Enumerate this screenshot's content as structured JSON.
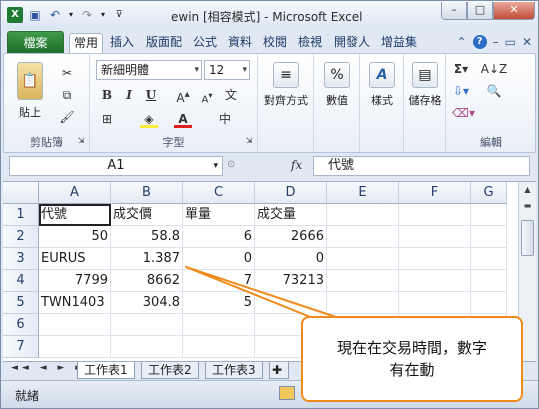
{
  "window": {
    "title": "ewin  [相容模式] - Microsoft Excel"
  },
  "titlebar": {
    "minimize": "–",
    "maximize": "□",
    "close": "✕"
  },
  "ribbon_tabs": {
    "file": "檔案",
    "tabs": [
      "常用",
      "插入",
      "版面配",
      "公式",
      "資料",
      "校閱",
      "檢視",
      "開發人",
      "增益集"
    ]
  },
  "ribbon": {
    "clipboard": {
      "label": "剪貼簿",
      "paste": "貼上"
    },
    "font": {
      "label": "字型",
      "name": "新細明體",
      "size": "12",
      "bold": "B",
      "italic": "I",
      "underline": "U"
    },
    "alignment": {
      "label": "對齊方式"
    },
    "number": {
      "label": "數值"
    },
    "styles": {
      "label": "樣式"
    },
    "cells": {
      "label": "儲存格"
    },
    "editing": {
      "label": "編輯"
    }
  },
  "formula_bar": {
    "name_box": "A1",
    "fx": "fx",
    "content": "代號"
  },
  "grid": {
    "columns": [
      "A",
      "B",
      "C",
      "D",
      "E",
      "F",
      "G"
    ],
    "rows": [
      "1",
      "2",
      "3",
      "4",
      "5",
      "6",
      "7"
    ],
    "cells": [
      [
        "代號",
        "成交價",
        "單量",
        "成交量",
        "",
        "",
        ""
      ],
      [
        "50",
        "58.8",
        "6",
        "2666",
        "",
        "",
        ""
      ],
      [
        "EURUS",
        "1.387",
        "0",
        "0",
        "",
        "",
        ""
      ],
      [
        "7799",
        "8662",
        "7",
        "73213",
        "",
        "",
        ""
      ],
      [
        "TWN1403",
        "304.8",
        "5",
        "",
        "",
        "",
        ""
      ],
      [
        "",
        "",
        "",
        "",
        "",
        "",
        ""
      ],
      [
        "",
        "",
        "",
        "",
        "",
        "",
        ""
      ]
    ]
  },
  "sheets": {
    "nav": "◄◄ ◄ ► ►►",
    "tabs": [
      "工作表1",
      "工作表2",
      "工作表3"
    ],
    "active": "工作表1"
  },
  "status": {
    "ready": "就緒"
  },
  "callout": {
    "line1": "現在在交易時間，數字",
    "line2": "有在動",
    "border_color": "#f08a1a"
  }
}
